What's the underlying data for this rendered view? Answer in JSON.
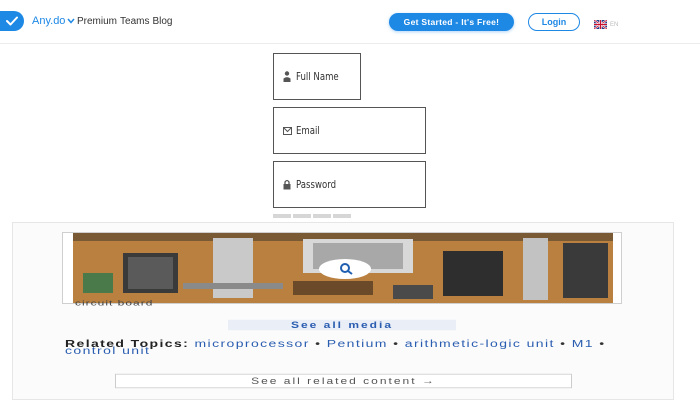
{
  "header": {
    "brand": "Any.do",
    "nav": [
      "Premium",
      "Teams",
      "Blog"
    ],
    "get_started_label": "Get Started - It's Free!",
    "login_label": "Login",
    "language_code": "EN"
  },
  "signup_form": {
    "full_name_placeholder": "Full Name",
    "email_placeholder": "Email",
    "password_placeholder": "Password",
    "strength_segments": 4
  },
  "embedded_content": {
    "image_caption": "circuit board",
    "see_all_media_label": "See all media",
    "related_heading": "Related Topics:",
    "related_links": [
      "microprocessor",
      "Pentium",
      "arithmetic-logic unit",
      "M1",
      "control unit"
    ],
    "separator": "•",
    "see_related_label": "See all related content →"
  },
  "colors": {
    "accent": "#1e88e5",
    "link": "#2a5db0",
    "border": "#555555"
  },
  "icons": [
    "checkmark-icon",
    "chevron-down-icon",
    "uk-flag-icon",
    "person-icon",
    "envelope-icon",
    "lock-icon",
    "zoom-icon"
  ]
}
